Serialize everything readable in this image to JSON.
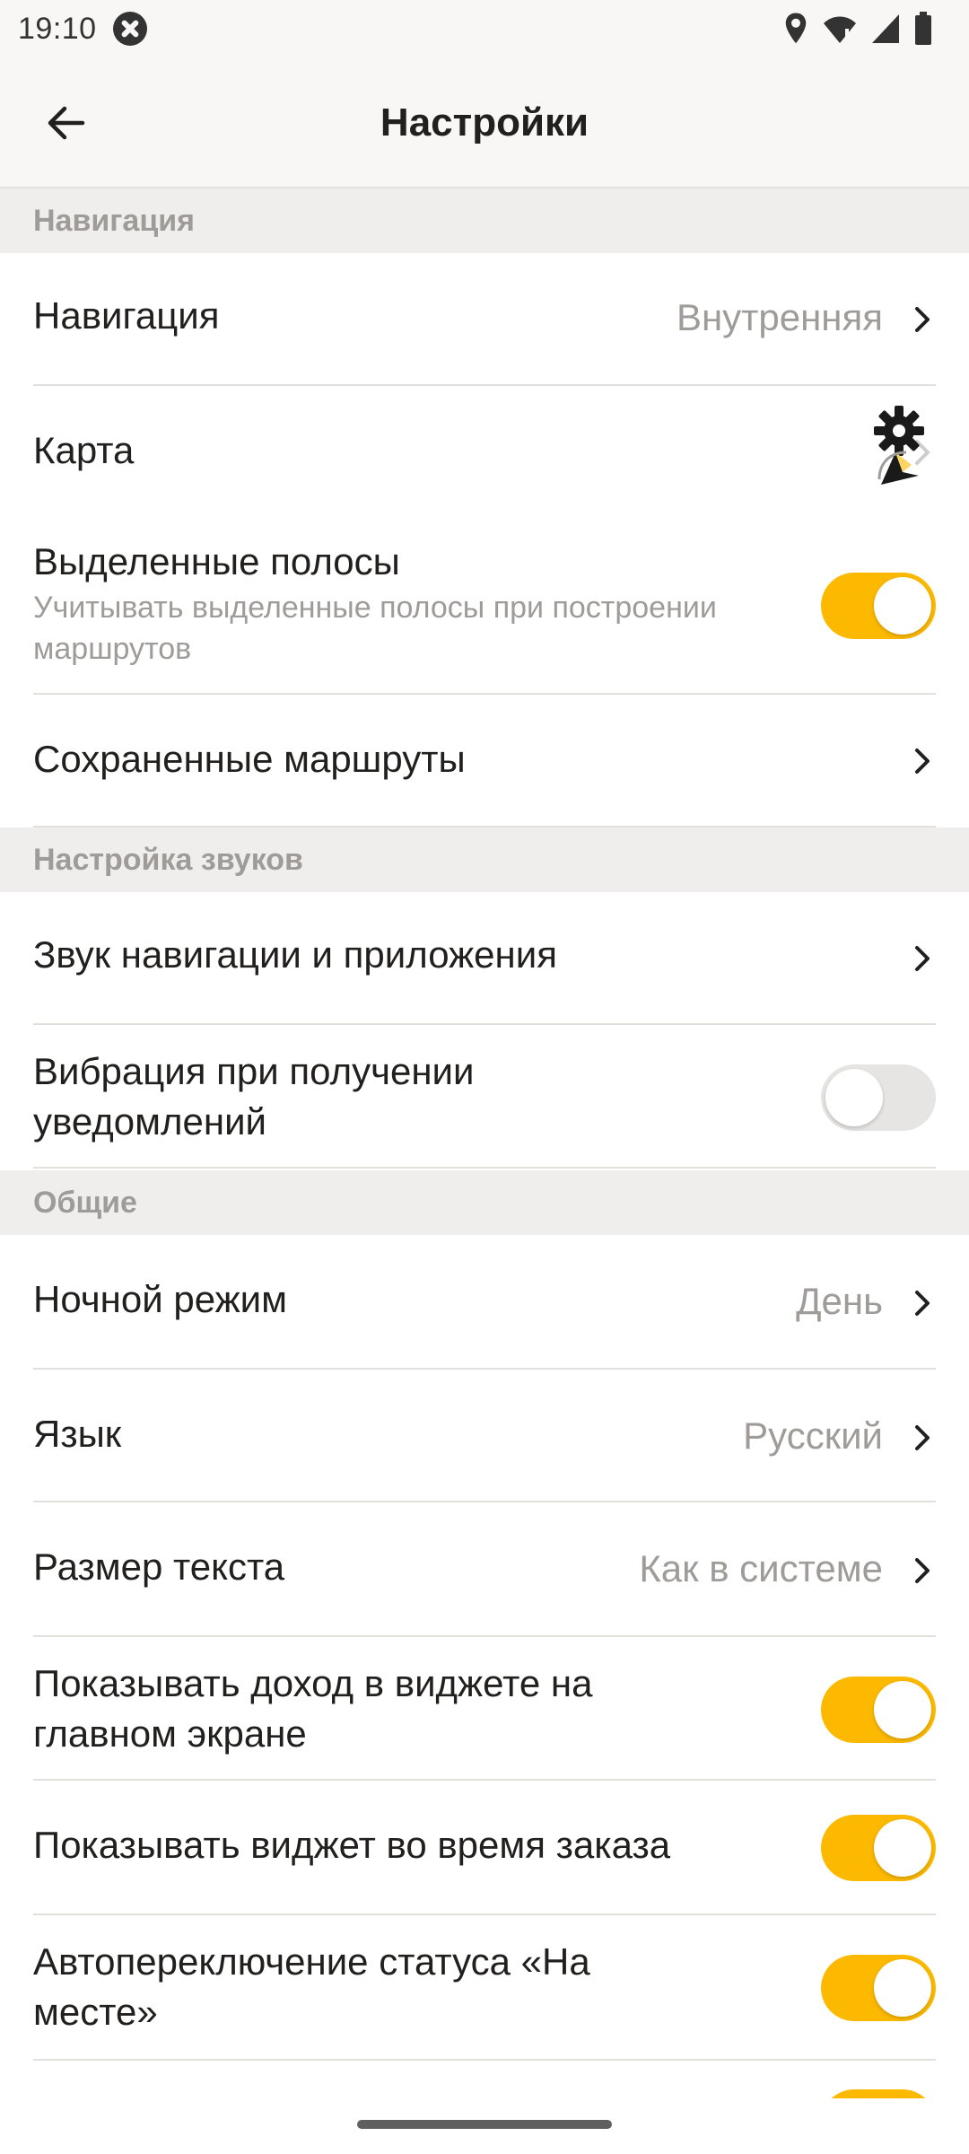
{
  "status_bar": {
    "time": "19:10",
    "icons": [
      "notification-x-icon",
      "location-icon",
      "wifi-icon",
      "cell-signal-icon",
      "battery-icon"
    ]
  },
  "app_bar": {
    "title": "Настройки",
    "back_icon": "arrow-left-icon"
  },
  "sections": [
    {
      "header": "Навигация",
      "items": [
        {
          "title": "Навигация",
          "value": "Внутренняя",
          "control": "chevron"
        },
        {
          "title": "Карта",
          "value": "",
          "control": "chevron"
        },
        {
          "title": "Выделенные полосы",
          "subtitle": "Учитывать выделенные полосы при построении маршрутов",
          "control": "toggle",
          "on": true
        },
        {
          "title": "Сохраненные маршруты",
          "control": "chevron"
        }
      ]
    },
    {
      "header": "Настройка звуков",
      "items": [
        {
          "title": "Звук навигации и приложения",
          "control": "chevron"
        },
        {
          "title": "Вибрация при получении уведомлений",
          "control": "toggle",
          "on": false
        }
      ]
    },
    {
      "header": "Общие",
      "items": [
        {
          "title": "Ночной режим",
          "value": "День",
          "control": "chevron"
        },
        {
          "title": "Язык",
          "value": "Русский",
          "control": "chevron"
        },
        {
          "title": "Размер текста",
          "value": "Как в системе",
          "control": "chevron"
        },
        {
          "title": "Показывать доход в виджете на главном экране",
          "control": "toggle",
          "on": true
        },
        {
          "title": "Показывать виджет во время заказа",
          "control": "toggle",
          "on": true
        },
        {
          "title": "Автопереключение статуса «На месте»",
          "control": "toggle",
          "on": true
        }
      ]
    }
  ],
  "colors": {
    "accent": "#fcb900",
    "section_bg": "#efeeec",
    "secondary_text": "#9e9b98"
  }
}
